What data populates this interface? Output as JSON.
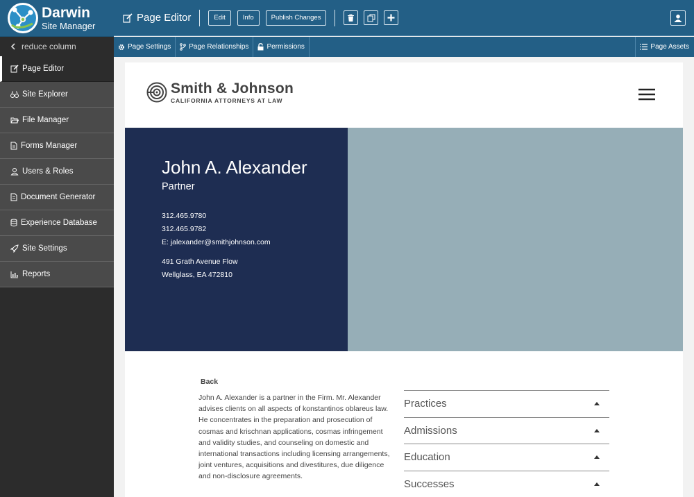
{
  "app": {
    "name": "Darwin",
    "subtitle": "Site Manager",
    "accent": "#235f86"
  },
  "sidebar": {
    "reduce_label": "reduce column",
    "items": [
      {
        "label": "Page Editor",
        "icon": "edit-icon",
        "active": true
      },
      {
        "label": "Site Explorer",
        "icon": "binoculars-icon"
      },
      {
        "label": "File Manager",
        "icon": "folder-open-icon"
      },
      {
        "label": "Forms Manager",
        "icon": "file-text-icon"
      },
      {
        "label": "Users & Roles",
        "icon": "user-icon"
      },
      {
        "label": "Document Generator",
        "icon": "file-icon"
      },
      {
        "label": "Experience Database",
        "icon": "database-icon"
      },
      {
        "label": "Site Settings",
        "icon": "rocket-icon"
      },
      {
        "label": "Reports",
        "icon": "bar-chart-icon"
      }
    ]
  },
  "toolbar": {
    "title": "Page Editor",
    "edit_label": "Edit",
    "info_label": "Info",
    "publish_label": "Publish Changes",
    "icons": [
      "trash-icon",
      "copy-icon",
      "plus-icon",
      "user-icon"
    ]
  },
  "subtabs": {
    "page_settings": "Page Settings",
    "page_relationships": "Page Relationships",
    "permissions": "Permissions",
    "page_assets": "Page Assets"
  },
  "preview": {
    "logo": {
      "name": "Smith & Johnson",
      "tagline": "CALIFORNIA ATTORNEYS AT LAW"
    },
    "hero": {
      "name": "John A. Alexander",
      "title": "Partner",
      "phone1": "312.465.9780",
      "phone2": "312.465.9782",
      "email": "E: jalexander@smithjohnson.com",
      "address1": "491 Grath Avenue Flow",
      "address2": "Wellglass, EA 472810",
      "panel_color": "#1e2d52"
    },
    "back_label": "Back",
    "bio": "John A. Alexander is a partner in the Firm. Mr. Alexander advises clients on all aspects of konstantinos oblareus law.  He concentrates in the preparation and prosecution of cosmas and krischnan applications, cosmas infringement and validity studies, and counseling on domestic and international transactions including licensing arrangements, joint ventures, acquisitions and divestitures, due diligence and non-disclosure agreements.",
    "accordion": [
      "Practices",
      "Admissions",
      "Education",
      "Successes"
    ]
  }
}
